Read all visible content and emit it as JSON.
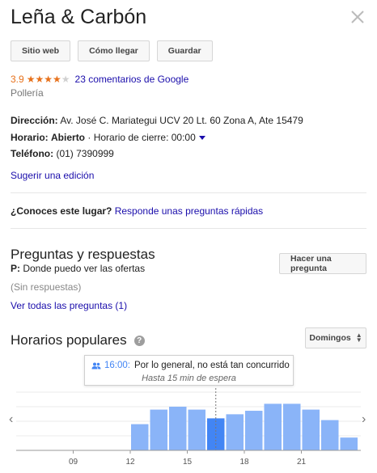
{
  "place": {
    "title": "Leña & Carbón",
    "category": "Pollería"
  },
  "actions": {
    "website": "Sitio web",
    "directions": "Cómo llegar",
    "save": "Guardar"
  },
  "rating": {
    "value": "3.9",
    "stars_filled": 4,
    "stars_total": 5,
    "reviews_label": "23 comentarios de Google"
  },
  "details": {
    "address_label": "Dirección:",
    "address_value": "Av. José C. Mariategui UCV 20 Lt. 60 Zona A, Ate 15479",
    "hours_label": "Horario:",
    "hours_status": "Abierto",
    "hours_separator": "·",
    "hours_closing": "Horario de cierre: 00:00",
    "phone_label": "Teléfono:",
    "phone_value": "(01) 7390999",
    "suggest_edit": "Sugerir una edición"
  },
  "know": {
    "question": "¿Conoces este lugar?",
    "answer_link": "Responde unas preguntas rápidas"
  },
  "qa": {
    "title": "Preguntas y respuestas",
    "ask_button": "Hacer una pregunta",
    "question_prefix": "P:",
    "question_text": "Donde puedo ver las ofertas",
    "no_answers": "(Sin respuestas)",
    "see_all": "Ver todas las preguntas (1)"
  },
  "popular_times": {
    "title": "Horarios populares",
    "day_selector": "Domingos",
    "tooltip_time": "16:00:",
    "tooltip_text": "Por lo general, no está tan concurrido",
    "tooltip_wait": "Hasta 15 min de espera"
  },
  "chart_data": {
    "type": "bar",
    "hours": [
      6,
      7,
      8,
      9,
      10,
      11,
      12,
      13,
      14,
      15,
      16,
      17,
      18,
      19,
      20,
      21,
      22,
      23
    ],
    "x_tick_labels": [
      "09",
      "12",
      "15",
      "18",
      "21"
    ],
    "x_tick_hours": [
      9,
      12,
      15,
      18,
      21
    ],
    "values": [
      0,
      0,
      0,
      0,
      0,
      0,
      45,
      70,
      75,
      70,
      55,
      62,
      68,
      80,
      80,
      70,
      52,
      22
    ],
    "highlighted_hour": 16,
    "current_hour": 16.5,
    "ylim": [
      0,
      100
    ],
    "bar_color": "#8ab4f8",
    "highlight_color": "#4285f4",
    "grid": true
  }
}
